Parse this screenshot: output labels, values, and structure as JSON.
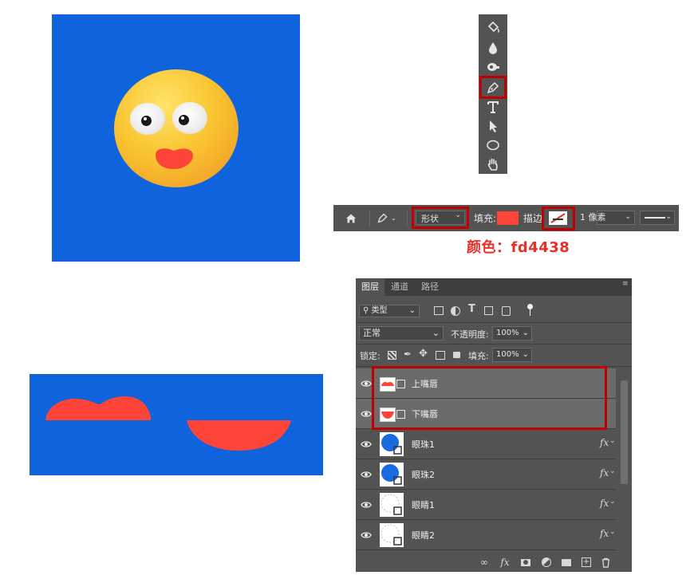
{
  "options_bar": {
    "mode_value": "形状",
    "fill_label": "填充:",
    "stroke_label": "描边",
    "stroke_width_value": "1 像素"
  },
  "caption": "颜色：fd4438",
  "colors": {
    "fill": "#fd4438",
    "canvas_blue": "#0f63dd",
    "highlight_red": "#c00000"
  },
  "layers_panel": {
    "tabs": [
      "图层",
      "通道",
      "路径"
    ],
    "filter_value": "类型",
    "blend_mode_value": "正常",
    "opacity_label": "不透明度:",
    "opacity_value": "100%",
    "lock_label": "锁定:",
    "fill_label": "填充:",
    "fill_value": "100%",
    "layers": [
      {
        "name": "上嘴唇",
        "fx": ""
      },
      {
        "name": "下嘴唇",
        "fx": ""
      },
      {
        "name": "眼珠1",
        "fx": "fx"
      },
      {
        "name": "眼珠2",
        "fx": "fx"
      },
      {
        "name": "眼睛1",
        "fx": "fx"
      },
      {
        "name": "眼睛2",
        "fx": "fx"
      }
    ]
  },
  "tools": [
    "paint-bucket-icon",
    "blur-drop-icon",
    "dodge-icon",
    "pen-icon",
    "type-icon",
    "path-selection-icon",
    "ellipse-icon",
    "hand-icon"
  ]
}
